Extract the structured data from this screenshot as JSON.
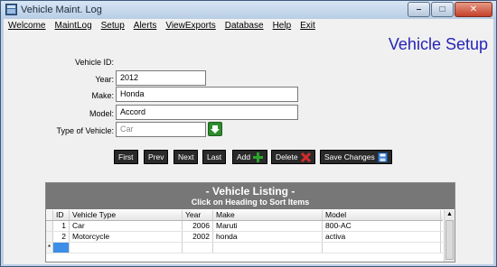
{
  "window": {
    "title": "Vehicle Maint. Log"
  },
  "menu": [
    "Welcome",
    "MaintLog",
    "Setup",
    "Alerts",
    "ViewExports",
    "Database",
    "Help",
    "Exit"
  ],
  "page": {
    "title": "Vehicle Setup"
  },
  "form": {
    "vehicle_id_label": "Vehicle ID:",
    "year_label": "Year:",
    "year_value": "2012",
    "make_label": "Make:",
    "make_value": "Honda",
    "model_label": "Model:",
    "model_value": "Accord",
    "type_label": "Type of Vehicle:",
    "type_placeholder": "Car"
  },
  "nav": {
    "first": "First",
    "prev": "Prev",
    "next": "Next",
    "last": "Last",
    "add": "Add",
    "delete": "Delete",
    "save": "Save  Changes"
  },
  "listing": {
    "title": "- Vehicle Listing -",
    "subtitle": "Click on Heading to Sort Items",
    "columns": [
      "ID",
      "Vehicle Type",
      "Year",
      "Make",
      "Model"
    ],
    "rows": [
      {
        "id": "1",
        "type": "Car",
        "year": "2006",
        "make": "Maruti",
        "model": "800-AC"
      },
      {
        "id": "2",
        "type": "Motorcycle",
        "year": "2002",
        "make": "honda",
        "model": "activa"
      }
    ],
    "new_row_marker": "*"
  },
  "colors": {
    "accent_title": "#2424b8",
    "nav_bg": "#2a2a2a",
    "add_icon": "#2aa52a",
    "delete_icon": "#d22a2a",
    "save_icon": "#3b7fd6"
  }
}
